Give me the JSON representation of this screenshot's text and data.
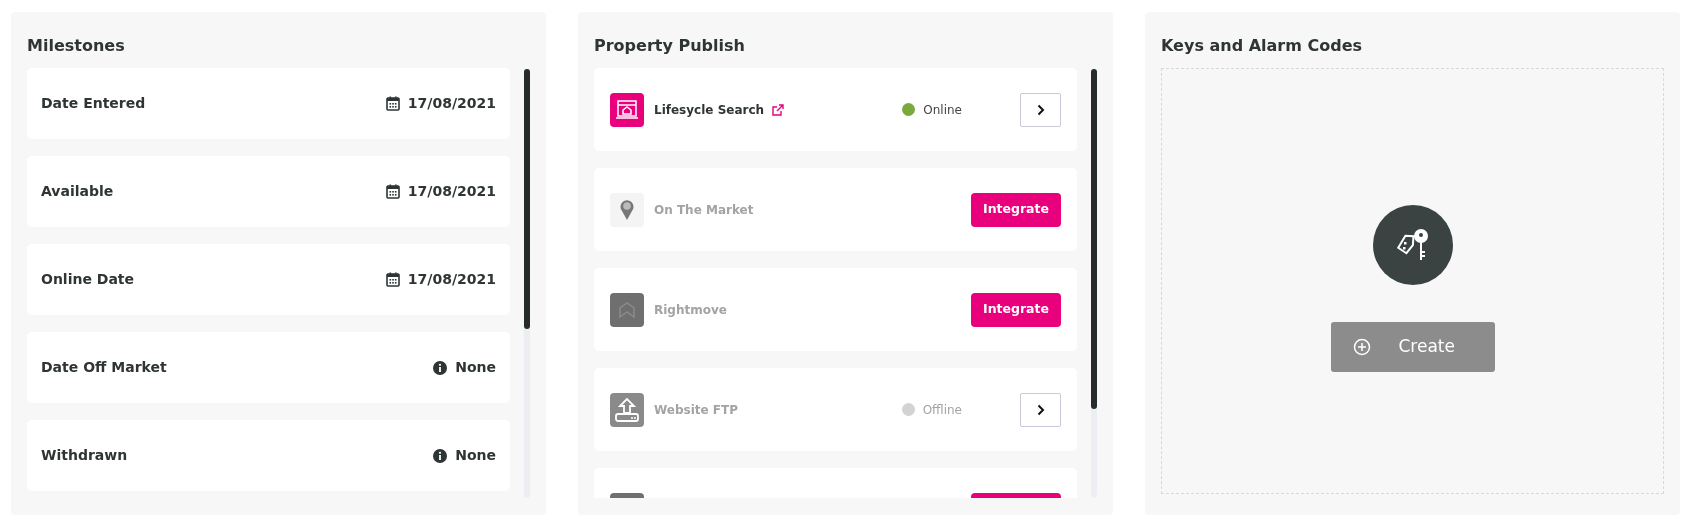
{
  "milestones": {
    "title": "Milestones",
    "items": [
      {
        "label": "Date Entered",
        "kind": "date",
        "value": "17/08/2021"
      },
      {
        "label": "Available",
        "kind": "date",
        "value": "17/08/2021"
      },
      {
        "label": "Online Date",
        "kind": "date",
        "value": "17/08/2021"
      },
      {
        "label": "Date Off Market",
        "kind": "none",
        "value": "None"
      },
      {
        "label": "Withdrawn",
        "kind": "none",
        "value": "None"
      }
    ]
  },
  "property_publish": {
    "title": "Property Publish",
    "items": [
      {
        "kind": "status",
        "name": "Lifesycle Search",
        "active": true,
        "external_link": true,
        "status": "Online",
        "color": "#7aab3a"
      },
      {
        "kind": "integrate",
        "name": "On The Market",
        "active": false,
        "button": "Integrate"
      },
      {
        "kind": "integrate",
        "name": "Rightmove",
        "active": false,
        "button": "Integrate"
      },
      {
        "kind": "status",
        "name": "Website FTP",
        "active": false,
        "external_link": false,
        "status": "Offline",
        "color": "#d3d3d3"
      },
      {
        "kind": "integrate"
      }
    ]
  },
  "keys": {
    "title": "Keys and Alarm Codes",
    "button": "Create"
  }
}
